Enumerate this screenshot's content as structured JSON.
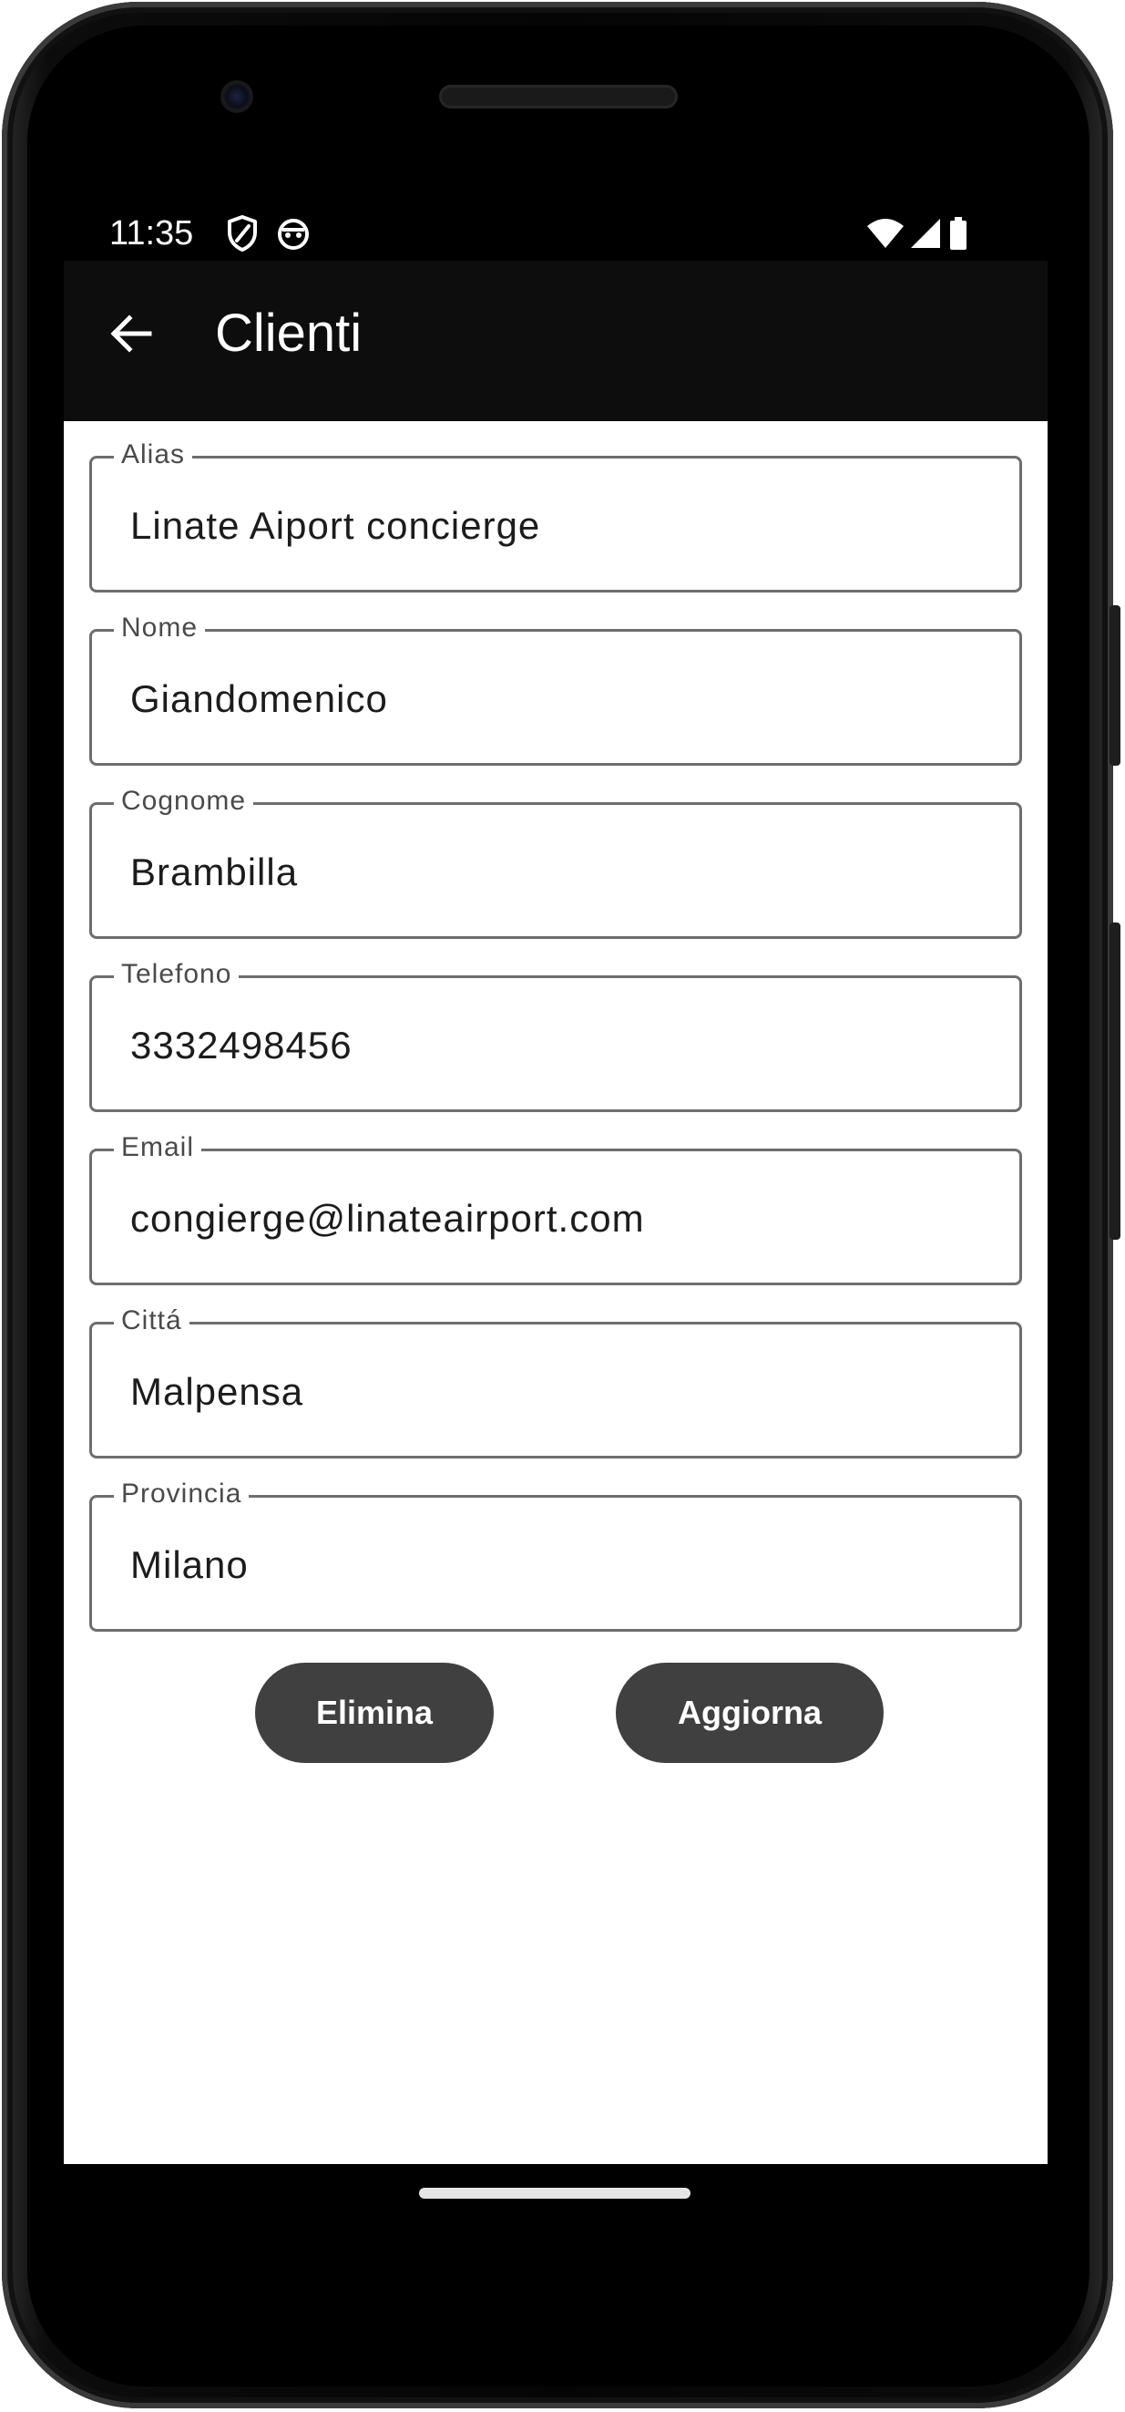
{
  "status_bar": {
    "time": "11:35",
    "left_icons": [
      "shield-icon",
      "app-notification-icon"
    ],
    "right_icons": [
      "wifi-icon",
      "cellular-signal-icon",
      "battery-icon"
    ]
  },
  "app_bar": {
    "title": "Clienti",
    "back_icon": "arrow-back-icon"
  },
  "form": {
    "fields": [
      {
        "label": "Alias",
        "value": "Linate Aiport concierge"
      },
      {
        "label": "Nome",
        "value": "Giandomenico"
      },
      {
        "label": "Cognome",
        "value": "Brambilla"
      },
      {
        "label": "Telefono",
        "value": "3332498456"
      },
      {
        "label": "Email",
        "value": "congierge@linateairport.com"
      },
      {
        "label": "Cittá",
        "value": "Malpensa"
      },
      {
        "label": "Provincia",
        "value": "Milano"
      }
    ]
  },
  "actions": {
    "delete_label": "Elimina",
    "update_label": "Aggiorna"
  },
  "colors": {
    "app_bar_bg": "#0d0d0d",
    "button_bg": "#404040",
    "field_border": "#6e6e6e"
  }
}
